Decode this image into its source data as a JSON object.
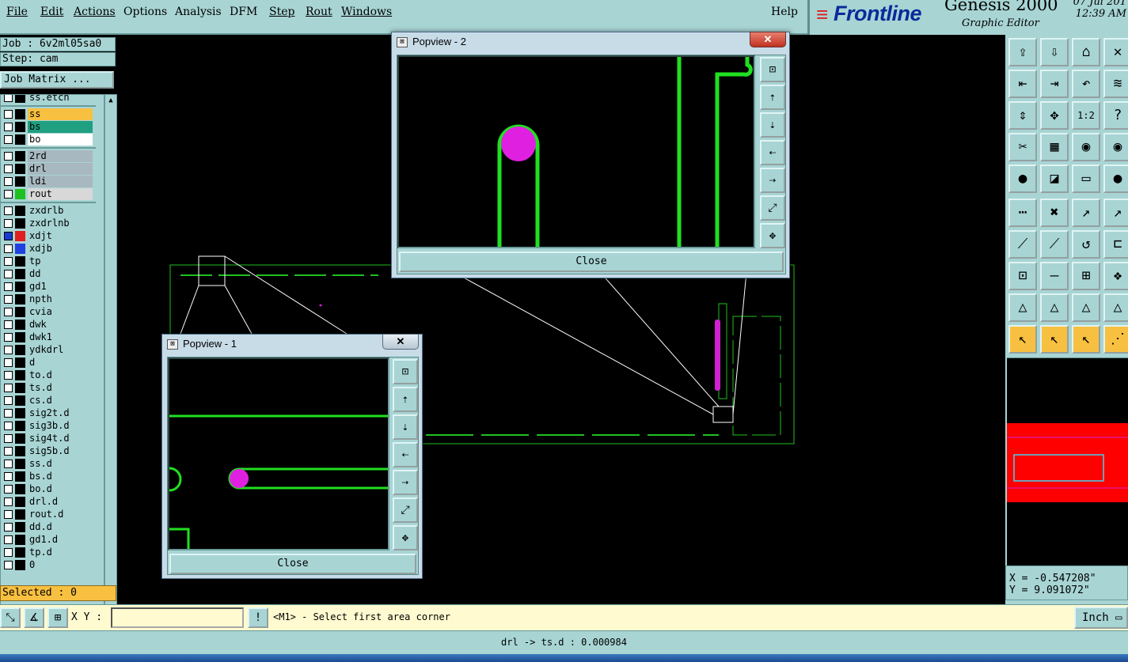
{
  "menubar": {
    "items": [
      {
        "label": "File"
      },
      {
        "label": "Edit"
      },
      {
        "label": "Actions"
      },
      {
        "label": "Options"
      },
      {
        "label": "Analysis"
      },
      {
        "label": "DFM"
      },
      {
        "label": "Step"
      },
      {
        "label": "Rout"
      },
      {
        "label": "Windows"
      }
    ],
    "help": "Help"
  },
  "brand": {
    "logo_text": "Frontline",
    "app_title": "Genesis 2000",
    "subtitle": "Graphic Editor",
    "date": "07 Jul 201",
    "time": "12:39 AM"
  },
  "job": {
    "label": "Job : 6v2ml05sa0",
    "step": "Step: cam",
    "matrix_button": "Job Matrix ..."
  },
  "layers": [
    {
      "name": "ss.etch",
      "color": "#000000",
      "bg": "#a8d4d4",
      "checked": false
    },
    {
      "name": "ss",
      "color": "#000000",
      "bg": "#f8c040",
      "checked": false
    },
    {
      "name": "bs",
      "color": "#000000",
      "bg": "#20a080",
      "checked": false
    },
    {
      "name": "bo",
      "color": "#000000",
      "bg": "#ffffff",
      "checked": false
    },
    {
      "name": "2rd",
      "color": "#000000",
      "bg": "#a8b8c0",
      "checked": false
    },
    {
      "name": "drl",
      "color": "#000000",
      "bg": "#a8b8c0",
      "checked": false
    },
    {
      "name": "ldi",
      "color": "#000000",
      "bg": "#a8b8c0",
      "checked": false
    },
    {
      "name": "rout",
      "color": "#20c020",
      "bg": "#d8d8d8",
      "checked": false
    },
    {
      "name": "zxdrlb",
      "color": "#000000",
      "bg": "#a8d4d4",
      "checked": false
    },
    {
      "name": "zxdrlnb",
      "color": "#000000",
      "bg": "#a8d4d4",
      "checked": false
    },
    {
      "name": "xdjt",
      "color": "#e02020",
      "bg": "#a8d4d4",
      "checked": true
    },
    {
      "name": "xdjb",
      "color": "#2040e0",
      "bg": "#a8d4d4",
      "checked": false
    },
    {
      "name": "tp",
      "color": "#000000",
      "bg": "#a8d4d4",
      "checked": false
    },
    {
      "name": "dd",
      "color": "#000000",
      "bg": "#a8d4d4",
      "checked": false
    },
    {
      "name": "gd1",
      "color": "#000000",
      "bg": "#a8d4d4",
      "checked": false
    },
    {
      "name": "npth",
      "color": "#000000",
      "bg": "#a8d4d4",
      "checked": false
    },
    {
      "name": "cvia",
      "color": "#000000",
      "bg": "#a8d4d4",
      "checked": false
    },
    {
      "name": "dwk",
      "color": "#000000",
      "bg": "#a8d4d4",
      "checked": false
    },
    {
      "name": "dwk1",
      "color": "#000000",
      "bg": "#a8d4d4",
      "checked": false
    },
    {
      "name": "ydkdrl",
      "color": "#000000",
      "bg": "#a8d4d4",
      "checked": false
    },
    {
      "name": "d",
      "color": "#000000",
      "bg": "#a8d4d4",
      "checked": false
    },
    {
      "name": "to.d",
      "color": "#000000",
      "bg": "#a8d4d4",
      "checked": false
    },
    {
      "name": "ts.d",
      "color": "#000000",
      "bg": "#a8d4d4",
      "checked": false
    },
    {
      "name": "cs.d",
      "color": "#000000",
      "bg": "#a8d4d4",
      "checked": false
    },
    {
      "name": "sig2t.d",
      "color": "#000000",
      "bg": "#a8d4d4",
      "checked": false
    },
    {
      "name": "sig3b.d",
      "color": "#000000",
      "bg": "#a8d4d4",
      "checked": false
    },
    {
      "name": "sig4t.d",
      "color": "#000000",
      "bg": "#a8d4d4",
      "checked": false
    },
    {
      "name": "sig5b.d",
      "color": "#000000",
      "bg": "#a8d4d4",
      "checked": false
    },
    {
      "name": "ss.d",
      "color": "#000000",
      "bg": "#a8d4d4",
      "checked": false
    },
    {
      "name": "bs.d",
      "color": "#000000",
      "bg": "#a8d4d4",
      "checked": false
    },
    {
      "name": "bo.d",
      "color": "#000000",
      "bg": "#a8d4d4",
      "checked": false
    },
    {
      "name": "drl.d",
      "color": "#000000",
      "bg": "#a8d4d4",
      "checked": false
    },
    {
      "name": "rout.d",
      "color": "#000000",
      "bg": "#a8d4d4",
      "checked": false
    },
    {
      "name": "dd.d",
      "color": "#000000",
      "bg": "#a8d4d4",
      "checked": false
    },
    {
      "name": "gd1.d",
      "color": "#000000",
      "bg": "#a8d4d4",
      "checked": false
    },
    {
      "name": "tp.d",
      "color": "#000000",
      "bg": "#a8d4d4",
      "checked": false
    },
    {
      "name": "0",
      "color": "#000000",
      "bg": "#a8d4d4",
      "checked": false
    }
  ],
  "selected": "Selected : 0",
  "popup1": {
    "title": "Popview - 1",
    "close": "Close",
    "x": "✕"
  },
  "popup2": {
    "title": "Popview - 2",
    "close": "Close",
    "x": "✕"
  },
  "coords": {
    "x": "X = -0.547208\"",
    "y": "Y = 9.091072\""
  },
  "status": {
    "xy_label": "X Y :",
    "xy_value": "",
    "prompt": "<M1> - Select first area corner",
    "units": "Inch"
  },
  "bottom_message": "drl -> ts.d : 0.000984",
  "colors": {
    "panel": "#a8d4d4",
    "rout": "#20e020",
    "pad": "#e020e0",
    "highlight": "#f8c040"
  }
}
